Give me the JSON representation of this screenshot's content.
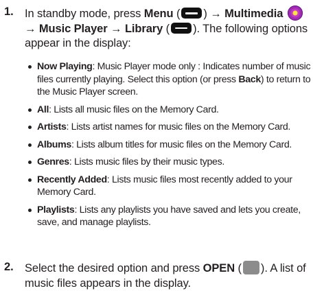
{
  "step1": {
    "number": "1.",
    "text_a": "In standby mode, press ",
    "menu": "Menu",
    "paren_open": " (",
    "paren_close_arrow": ") → ",
    "multimedia": "Multimedia",
    "arrow": "→ ",
    "music_player": "Music Player",
    "arrow2": " → ",
    "library": "Library",
    "text_b": "). The following options appear in the display:"
  },
  "bullets": [
    {
      "term": "Now Playing",
      "desc_a": ": Music Player mode only : Indicates number of music files currently playing. Select this option (or press ",
      "back": "Back",
      "desc_b": ") to return to the Music Player screen."
    },
    {
      "term": "All",
      "desc": ": Lists all music files on the Memory Card."
    },
    {
      "term": "Artists",
      "desc": ": Lists artist names for music files on the Memory Card."
    },
    {
      "term": "Albums",
      "desc": ": Lists album titles for music files on the Memory Card."
    },
    {
      "term": "Genres",
      "desc": ": Lists music files by their music types."
    },
    {
      "term": "Recently Added",
      "desc": ": Lists music files most recently added to your Memory Card."
    },
    {
      "term": "Playlists",
      "desc": ": Lists any playlists you have saved and lets you create, save, and manage playlists."
    }
  ],
  "step2": {
    "number": "2.",
    "text_a": "Select the desired option and press ",
    "open": "OPEN",
    "paren_open": " (",
    "text_b": "). A list of music files appears in the display."
  },
  "icons": {
    "menu_key": "left-softkey-icon",
    "multimedia": "multimedia-disc-icon",
    "library_key": "right-softkey-icon",
    "ok_key": "ok-key-icon"
  }
}
